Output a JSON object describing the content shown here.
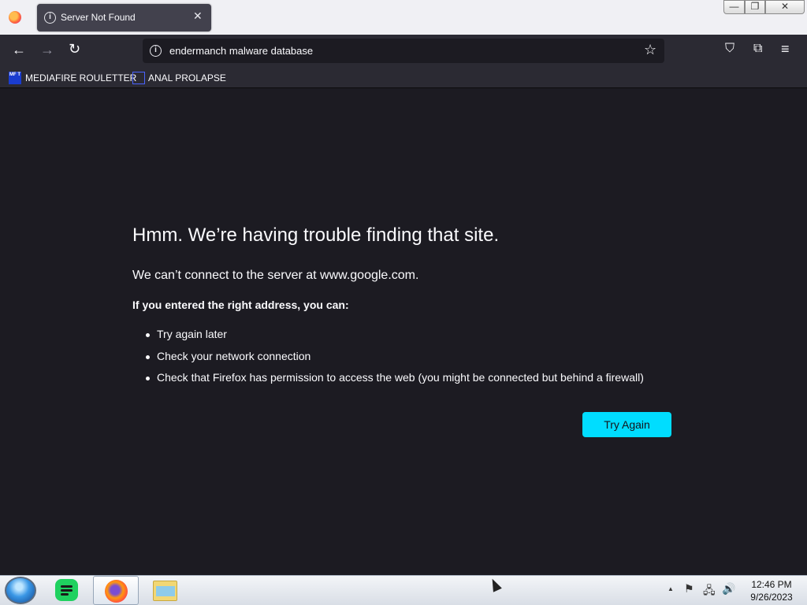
{
  "tab": {
    "title": "Server Not Found",
    "close": "✕",
    "info": "i"
  },
  "window_controls": {
    "minimize": "—",
    "maximize": "❐",
    "close": "✕"
  },
  "nav": {
    "back": "←",
    "forward": "→",
    "reload": "↻",
    "pocket": "⛉",
    "extensions": "⧉",
    "menu": "≡"
  },
  "urlbar": {
    "value": "endermanch malware database",
    "info": "i",
    "star": "☆"
  },
  "bookmarks": [
    {
      "icon_text": "MF T",
      "label": "MEDIAFIRE ROULETTER"
    },
    {
      "label": "ANAL PROLAPSE"
    }
  ],
  "error": {
    "title": "Hmm. We’re having trouble finding that site.",
    "description": "We can’t connect to the server at www.google.com.",
    "subheading": "If you entered the right address, you can:",
    "suggestions": [
      "Try again later",
      "Check your network connection",
      "Check that Firefox has permission to access the web (you might be connected but behind a firewall)"
    ],
    "button": "Try Again"
  },
  "taskbar": {
    "tray": {
      "up_arrow": "▲",
      "flag": "⚑",
      "network": "🖧",
      "volume": "🔊"
    },
    "clock_time": "12:46 PM",
    "clock_date": "9/26/2023"
  },
  "colors": {
    "accent": "#00ddff",
    "page_bg": "#1c1b22",
    "toolbar_bg": "#2b2a33"
  }
}
